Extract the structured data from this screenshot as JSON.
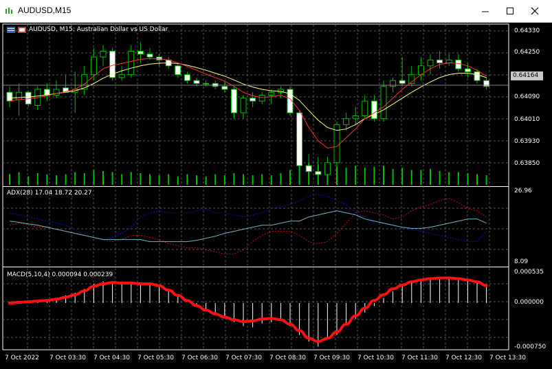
{
  "window": {
    "title": "AUDUSD,M15",
    "minimize_icon": "minimize-icon",
    "maximize_icon": "maximize-icon",
    "close_icon": "close-icon"
  },
  "main_pane": {
    "symbol_label": "AUDUSD, M15:  Australian Dollar vs US Dollar",
    "price_ticks": [
      "0.64330",
      "0.64250",
      "0.64090",
      "0.64010",
      "0.63930",
      "0.63850"
    ],
    "current_price": "0.64164"
  },
  "adx_pane": {
    "label": "ADX(28) 17.04 18.72 20.27",
    "scale_max": "26.96",
    "scale_min": "8.09"
  },
  "macd_pane": {
    "label": "MACD(5,10,4) 0.000094 0.000239",
    "scale_max": "0.000535",
    "scale_zero": "0.000000",
    "scale_min": "-0.000750"
  },
  "time_axis": [
    "7 Oct 2022",
    "7 Oct 03:30",
    "7 Oct 04:30",
    "7 Oct 05:30",
    "7 Oct 06:30",
    "7 Oct 07:30",
    "7 Oct 08:30",
    "7 Oct 09:30",
    "7 Oct 10:30",
    "7 Oct 11:30",
    "7 Oct 12:30",
    "7 Oct 13:30"
  ],
  "colors": {
    "background": "#000000",
    "grid": "#5a5a5a",
    "bull_candle": "#000000",
    "bear_candle": "#ffffff",
    "wick": "#00c000",
    "fast_ma": "#ff3030",
    "slow_ma": "#ffff80",
    "volume": "#00c000",
    "adx_main": "#6fb7c8",
    "adx_plus_di": "#1010c8",
    "adx_minus_di": "#c81010",
    "macd_hist": "#ffffff",
    "macd_signal": "#ff1010"
  },
  "chart_data": {
    "type": "candlestick",
    "symbol": "AUDUSD",
    "timeframe": "M15",
    "ylim": [
      0.6382,
      0.6437
    ],
    "candles": [
      {
        "o": 0.6414,
        "h": 0.6416,
        "l": 0.6409,
        "c": 0.6411
      },
      {
        "o": 0.64115,
        "h": 0.6417,
        "l": 0.6406,
        "c": 0.6414
      },
      {
        "o": 0.6414,
        "h": 0.64145,
        "l": 0.6409,
        "c": 0.641
      },
      {
        "o": 0.64095,
        "h": 0.6416,
        "l": 0.6408,
        "c": 0.6415
      },
      {
        "o": 0.6415,
        "h": 0.6417,
        "l": 0.6411,
        "c": 0.6413
      },
      {
        "o": 0.6413,
        "h": 0.6418,
        "l": 0.6412,
        "c": 0.6415
      },
      {
        "o": 0.64155,
        "h": 0.642,
        "l": 0.6414,
        "c": 0.6414
      },
      {
        "o": 0.6414,
        "h": 0.6421,
        "l": 0.6407,
        "c": 0.6415
      },
      {
        "o": 0.6415,
        "h": 0.6423,
        "l": 0.6413,
        "c": 0.642
      },
      {
        "o": 0.642,
        "h": 0.6429,
        "l": 0.6418,
        "c": 0.6426
      },
      {
        "o": 0.6426,
        "h": 0.643,
        "l": 0.6423,
        "c": 0.6428
      },
      {
        "o": 0.6428,
        "h": 0.6429,
        "l": 0.6418,
        "c": 0.6419
      },
      {
        "o": 0.6419,
        "h": 0.6423,
        "l": 0.6418,
        "c": 0.642
      },
      {
        "o": 0.642,
        "h": 0.643,
        "l": 0.6419,
        "c": 0.6428
      },
      {
        "o": 0.6428,
        "h": 0.6431,
        "l": 0.6424,
        "c": 0.6427
      },
      {
        "o": 0.6427,
        "h": 0.6429,
        "l": 0.6425,
        "c": 0.6426
      },
      {
        "o": 0.6426,
        "h": 0.6427,
        "l": 0.6423,
        "c": 0.6425
      },
      {
        "o": 0.6425,
        "h": 0.6426,
        "l": 0.6422,
        "c": 0.6423
      },
      {
        "o": 0.6423,
        "h": 0.6424,
        "l": 0.6419,
        "c": 0.642
      },
      {
        "o": 0.642,
        "h": 0.6421,
        "l": 0.6417,
        "c": 0.6418
      },
      {
        "o": 0.6418,
        "h": 0.6419,
        "l": 0.6416,
        "c": 0.6417
      },
      {
        "o": 0.6417,
        "h": 0.6418,
        "l": 0.6416,
        "c": 0.6417
      },
      {
        "o": 0.6417,
        "h": 0.6418,
        "l": 0.6415,
        "c": 0.6416
      },
      {
        "o": 0.6416,
        "h": 0.6418,
        "l": 0.6414,
        "c": 0.6415
      },
      {
        "o": 0.6415,
        "h": 0.6416,
        "l": 0.6405,
        "c": 0.6407
      },
      {
        "o": 0.6407,
        "h": 0.6413,
        "l": 0.6405,
        "c": 0.6412
      },
      {
        "o": 0.6412,
        "h": 0.6414,
        "l": 0.6409,
        "c": 0.6411
      },
      {
        "o": 0.6411,
        "h": 0.6414,
        "l": 0.641,
        "c": 0.6413
      },
      {
        "o": 0.6413,
        "h": 0.6415,
        "l": 0.641,
        "c": 0.6414
      },
      {
        "o": 0.6414,
        "h": 0.6416,
        "l": 0.6412,
        "c": 0.6415
      },
      {
        "o": 0.6415,
        "h": 0.6416,
        "l": 0.6406,
        "c": 0.6407
      },
      {
        "o": 0.6407,
        "h": 0.6408,
        "l": 0.6388,
        "c": 0.6389
      },
      {
        "o": 0.6389,
        "h": 0.6393,
        "l": 0.6384,
        "c": 0.6387
      },
      {
        "o": 0.6387,
        "h": 0.6392,
        "l": 0.6383,
        "c": 0.6386
      },
      {
        "o": 0.6386,
        "h": 0.6392,
        "l": 0.6384,
        "c": 0.639
      },
      {
        "o": 0.639,
        "h": 0.6404,
        "l": 0.6388,
        "c": 0.6403
      },
      {
        "o": 0.6403,
        "h": 0.6407,
        "l": 0.6401,
        "c": 0.6405
      },
      {
        "o": 0.6405,
        "h": 0.6409,
        "l": 0.6403,
        "c": 0.6406
      },
      {
        "o": 0.6406,
        "h": 0.6413,
        "l": 0.6405,
        "c": 0.6411
      },
      {
        "o": 0.6411,
        "h": 0.6413,
        "l": 0.6404,
        "c": 0.6405
      },
      {
        "o": 0.6405,
        "h": 0.6418,
        "l": 0.6404,
        "c": 0.6416
      },
      {
        "o": 0.6416,
        "h": 0.6419,
        "l": 0.6414,
        "c": 0.6418
      },
      {
        "o": 0.6418,
        "h": 0.6426,
        "l": 0.6416,
        "c": 0.6417
      },
      {
        "o": 0.6417,
        "h": 0.6423,
        "l": 0.6416,
        "c": 0.642
      },
      {
        "o": 0.642,
        "h": 0.6426,
        "l": 0.6418,
        "c": 0.6423
      },
      {
        "o": 0.6423,
        "h": 0.6427,
        "l": 0.642,
        "c": 0.6425
      },
      {
        "o": 0.6425,
        "h": 0.6428,
        "l": 0.6422,
        "c": 0.6424
      },
      {
        "o": 0.6424,
        "h": 0.6427,
        "l": 0.6423,
        "c": 0.6425
      },
      {
        "o": 0.6425,
        "h": 0.6427,
        "l": 0.6421,
        "c": 0.6422
      },
      {
        "o": 0.6422,
        "h": 0.6424,
        "l": 0.6419,
        "c": 0.6421
      },
      {
        "o": 0.6421,
        "h": 0.6422,
        "l": 0.6417,
        "c": 0.6418
      },
      {
        "o": 0.6418,
        "h": 0.6419,
        "l": 0.6415,
        "c": 0.6416
      }
    ],
    "fast_ma": [
      0.6411,
      0.64115,
      0.64118,
      0.64122,
      0.64128,
      0.64136,
      0.64142,
      0.6415,
      0.64168,
      0.64195,
      0.6422,
      0.64232,
      0.64238,
      0.64245,
      0.64252,
      0.64255,
      0.64254,
      0.6425,
      0.6424,
      0.64228,
      0.64215,
      0.64202,
      0.6419,
      0.64178,
      0.6416,
      0.6414,
      0.64128,
      0.64122,
      0.64125,
      0.6413,
      0.64118,
      0.64078,
      0.6402,
      0.63975,
      0.6395,
      0.63955,
      0.63985,
      0.64015,
      0.6405,
      0.6407,
      0.6409,
      0.6412,
      0.6415,
      0.64175,
      0.642,
      0.6422,
      0.64235,
      0.6424,
      0.64238,
      0.6423,
      0.64215,
      0.64195
    ],
    "slow_ma": [
      0.6412,
      0.64122,
      0.64124,
      0.64127,
      0.64131,
      0.64136,
      0.6414,
      0.64145,
      0.64155,
      0.6417,
      0.64188,
      0.64202,
      0.64213,
      0.64222,
      0.6423,
      0.64236,
      0.64239,
      0.6424,
      0.64238,
      0.64232,
      0.64224,
      0.64215,
      0.64205,
      0.64195,
      0.64182,
      0.64168,
      0.64158,
      0.6415,
      0.64145,
      0.64143,
      0.64135,
      0.64112,
      0.64078,
      0.64045,
      0.6402,
      0.6401,
      0.64015,
      0.6403,
      0.6405,
      0.64065,
      0.6408,
      0.641,
      0.6412,
      0.6414,
      0.64158,
      0.64175,
      0.6419,
      0.642,
      0.64205,
      0.64205,
      0.642,
      0.6419
    ],
    "volume": [
      0.5,
      0.6,
      0.4,
      0.55,
      0.5,
      0.45,
      0.5,
      0.6,
      0.55,
      0.7,
      0.65,
      0.6,
      0.5,
      0.6,
      0.55,
      0.5,
      0.45,
      0.5,
      0.4,
      0.5,
      0.45,
      0.4,
      0.5,
      0.45,
      0.55,
      0.5,
      0.45,
      0.5,
      0.45,
      0.55,
      0.7,
      0.9,
      1.0,
      0.95,
      0.9,
      0.85,
      0.8,
      0.9,
      0.8,
      0.85,
      0.9,
      0.75,
      0.8,
      0.7,
      0.7,
      0.75,
      0.65,
      0.6,
      0.6,
      0.55,
      0.5,
      0.45
    ],
    "adx": {
      "ylim": [
        8.09,
        26.96
      ],
      "adx": [
        19.0,
        18.7,
        18.3,
        18.0,
        17.5,
        17.0,
        16.5,
        16.0,
        15.5,
        15.0,
        14.5,
        14.5,
        14.5,
        14.5,
        14.5,
        14.0,
        14.0,
        14.0,
        14.0,
        14.0,
        14.3,
        14.8,
        15.3,
        16.0,
        16.5,
        17.0,
        17.5,
        18.0,
        18.0,
        18.5,
        19.0,
        19.0,
        20.0,
        20.5,
        21.0,
        21.5,
        21.0,
        20.5,
        19.5,
        19.0,
        18.5,
        18.0,
        17.5,
        17.2,
        17.2,
        17.5,
        18.0,
        18.5,
        19.0,
        19.5,
        19.5,
        18.5
      ],
      "plus_di": [
        21.0,
        20.5,
        20.0,
        19.5,
        19.0,
        18.5,
        18.0,
        17.0,
        15.5,
        15.0,
        14.5,
        15.0,
        16.0,
        17.5,
        20.0,
        21.0,
        21.5,
        21.0,
        21.0,
        21.0,
        21.5,
        22.0,
        21.0,
        21.0,
        20.5,
        20.0,
        20.5,
        21.0,
        22.0,
        22.5,
        23.0,
        24.0,
        25.0,
        25.5,
        25.0,
        24.0,
        23.0,
        21.0,
        20.0,
        19.0,
        18.5,
        18.0,
        17.5,
        17.0,
        16.5,
        16.0,
        15.5,
        15.0,
        14.5,
        14.0,
        14.0,
        16.5
      ],
      "minus_di": [
        18.0,
        18.5,
        18.0,
        17.5,
        17.5,
        17.0,
        16.5,
        16.0,
        15.5,
        15.0,
        14.5,
        14.0,
        14.5,
        15.5,
        15.5,
        15.0,
        14.5,
        13.5,
        13.0,
        12.5,
        12.5,
        12.0,
        11.5,
        11.0,
        11.0,
        12.0,
        14.0,
        15.5,
        16.5,
        16.5,
        16.5,
        15.5,
        14.0,
        13.5,
        14.0,
        16.0,
        18.5,
        21.0,
        21.5,
        21.0,
        20.5,
        19.5,
        20.0,
        21.5,
        22.5,
        23.0,
        24.0,
        24.5,
        23.5,
        22.0,
        21.5,
        20.0
      ]
    },
    "macd": {
      "ylim": [
        -0.00075,
        0.000535
      ],
      "histogram": [
        2e-05,
        3e-05,
        4e-05,
        5e-05,
        6e-05,
        8e-05,
        0.00012,
        0.00016,
        0.00022,
        0.0003,
        0.00034,
        0.00034,
        0.00033,
        0.00032,
        0.00031,
        0.00031,
        0.00028,
        0.00018,
        0.0001,
        0.0,
        -6e-05,
        -0.00012,
        -0.00018,
        -0.00022,
        -0.0003,
        -0.00036,
        -0.00038,
        -0.00032,
        -0.0003,
        -0.00028,
        -0.00036,
        -0.0005,
        -0.0006,
        -0.00068,
        -0.00055,
        -0.0005,
        -0.00035,
        -0.00025,
        -0.00015,
        -5e-05,
        8e-05,
        0.00018,
        0.00028,
        0.00034,
        0.00038,
        0.0004,
        0.0004,
        0.0004,
        0.00039,
        0.00037,
        0.00034,
        0.00025
      ],
      "signal": [
        0.0,
        1e-05,
        2e-05,
        3e-05,
        4e-05,
        6e-05,
        9e-05,
        0.00013,
        0.00019,
        0.00026,
        0.0003,
        0.00032,
        0.00031,
        0.00031,
        0.0003,
        0.0003,
        0.00027,
        0.0002,
        0.00012,
        4e-05,
        -4e-05,
        -0.00011,
        -0.00017,
        -0.00022,
        -0.00026,
        -0.00029,
        -0.00028,
        -0.00025,
        -0.00024,
        -0.00026,
        -0.00033,
        -0.00043,
        -0.00055,
        -0.0006,
        -0.00055,
        -0.00045,
        -0.00033,
        -0.0002,
        -8e-05,
        4e-05,
        0.00013,
        0.00022,
        0.00028,
        0.00033,
        0.00036,
        0.00038,
        0.00039,
        0.00039,
        0.00038,
        0.00036,
        0.00033,
        0.00027
      ]
    }
  }
}
